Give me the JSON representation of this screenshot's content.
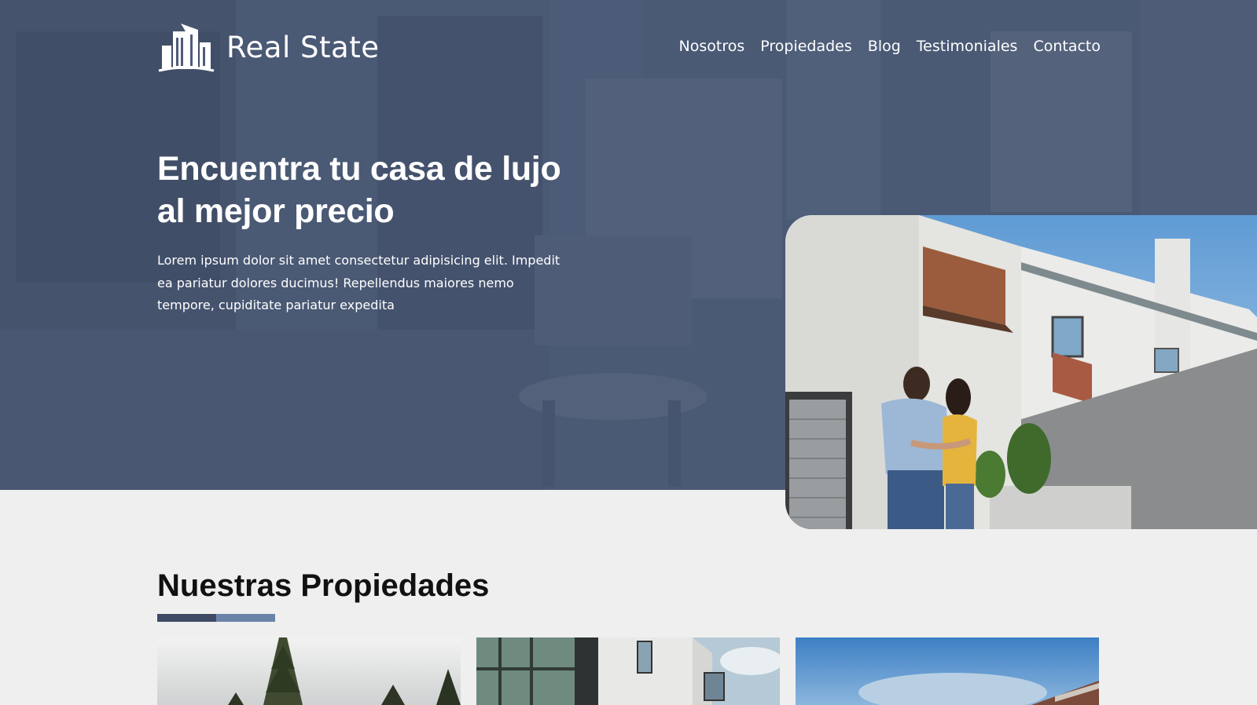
{
  "brand": {
    "name": "Real State",
    "logo_icon": "buildings-icon"
  },
  "nav": {
    "items": [
      "Nosotros",
      "Propiedades",
      "Blog",
      "Testimoniales",
      "Contacto"
    ]
  },
  "hero": {
    "title": "Encuentra tu casa de lujo al mejor precio",
    "text": "Lorem ipsum dolor sit amet consectetur adipisicing elit. Impedit ea pariatur dolores ducimus! Repellendus maiores nemo tempore, cupiditate pariatur expedita",
    "overlay_color": "#425270"
  },
  "properties": {
    "title_light": "Nuestras",
    "title_bold": "Propiedades",
    "bar_colors": [
      "#3e4a66",
      "#6c83a9"
    ],
    "cards": [
      {
        "image": "forest-house-photo"
      },
      {
        "image": "modern-building-photo"
      },
      {
        "image": "sky-house-photo"
      }
    ]
  }
}
